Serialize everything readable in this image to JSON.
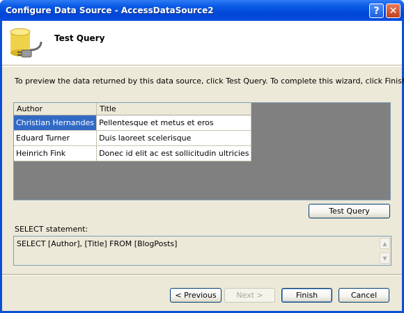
{
  "window": {
    "title": "Configure Data Source - AccessDataSource2",
    "help_glyph": "?",
    "close_glyph": "✕"
  },
  "header": {
    "title": "Test Query",
    "icon": "database-connection-icon"
  },
  "instructions": "To preview the data returned by this data source, click Test Query. To complete this wizard, click Finish.",
  "grid": {
    "columns": [
      "Author",
      "Title"
    ],
    "rows": [
      {
        "author": "Christian Hernandes",
        "title": "Pellentesque et metus et eros",
        "selected": true
      },
      {
        "author": "Eduard Turner",
        "title": "Duis laoreet scelerisque",
        "selected": false
      },
      {
        "author": "Heinrich Fink",
        "title": "Donec id elit ac est sollicitudin ultricies",
        "selected": false
      }
    ]
  },
  "buttons": {
    "test_query": "Test Query",
    "previous": "< Previous",
    "next": "Next >",
    "finish": "Finish",
    "cancel": "Cancel"
  },
  "select_statement": {
    "label": "SELECT statement:",
    "value": "SELECT [Author], [Title] FROM [BlogPosts]"
  },
  "colors": {
    "titlebar": "#0a4fd6",
    "selection": "#316ac5",
    "dialog_bg": "#ece9d8"
  }
}
